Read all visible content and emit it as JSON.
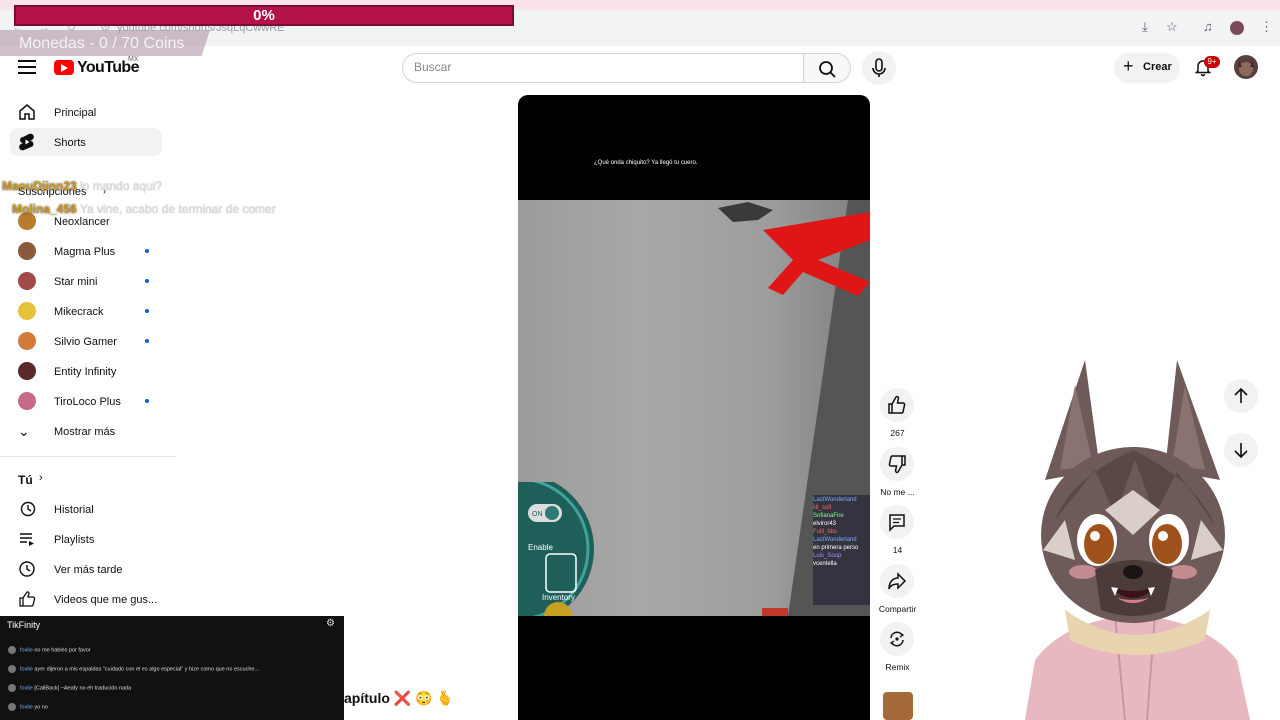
{
  "browser": {
    "url": "youtube.com/shorts/JsqLqCwwRE",
    "icons": [
      "back-icon",
      "forward-icon",
      "reload-icon",
      "site-info-icon",
      "install-icon",
      "star-icon",
      "media-icon",
      "profile-icon",
      "more-icon"
    ]
  },
  "overlay": {
    "progress_label": "0%",
    "progress_value": 0,
    "coins_label": "Monedas - 0 / 70 Coins",
    "chat": [
      {
        "user": "MaouDjinn23",
        "message": "lo mando aqui?"
      },
      {
        "user": "Molina_456",
        "message": "Ya vine, acabo de terminar de comer"
      }
    ]
  },
  "header": {
    "logo": "YouTube",
    "country": "MX",
    "search_placeholder": "Buscar",
    "create_label": "Crear",
    "notif_count": "9+",
    "colors": {
      "brand": "#ff0000",
      "badge": "#cc0000"
    }
  },
  "sidebar": {
    "main": [
      {
        "label": "Principal",
        "icon": "home-icon"
      },
      {
        "label": "Shorts",
        "icon": "shorts-icon",
        "active": true
      }
    ],
    "subs_title": "Suscripciones",
    "subs": [
      {
        "label": "Neoxlancer",
        "dot": false,
        "color": "#b87a2e"
      },
      {
        "label": "Magma Plus",
        "dot": true,
        "color": "#8b5a3c"
      },
      {
        "label": "Star mini",
        "dot": true,
        "color": "#a04a4a"
      },
      {
        "label": "Mikecrack",
        "dot": true,
        "color": "#e6c23a"
      },
      {
        "label": "Silvio Gamer",
        "dot": true,
        "color": "#d17a3a"
      },
      {
        "label": "Entity Infinity",
        "dot": false,
        "color": "#5a2a2a"
      },
      {
        "label": "TiroLoco Plus",
        "dot": true,
        "color": "#c46a8a"
      }
    ],
    "show_more": "Mostrar más",
    "you_title": "Tú",
    "you_items": [
      {
        "label": "Historial",
        "icon": "history-icon"
      },
      {
        "label": "Playlists",
        "icon": "playlists-icon"
      },
      {
        "label": "Ver más tarde",
        "icon": "watch-later-icon"
      },
      {
        "label": "Videos que me gus...",
        "icon": "liked-icon"
      }
    ]
  },
  "video": {
    "caption": "¿Qué onda chiquito? Ya llegó tu cuero.",
    "title_fragment": "apítulo ❌ 😳 🫰",
    "hud": {
      "toggle_on": "ON",
      "enable_label": "Enable",
      "inventory_label": "Inventory",
      "chat_lines": [
        "LastWonderland",
        "lilt_soll",
        "SofianaFire",
        "elviror43",
        "Fulli_bbs",
        "LastWonderland",
        "en primera perso",
        "Luis_Soup",
        "vcentella"
      ]
    }
  },
  "actions": [
    {
      "name": "like",
      "icon": "like-icon",
      "label": "267"
    },
    {
      "name": "dislike",
      "icon": "dislike-icon",
      "label": "No me ..."
    },
    {
      "name": "comments",
      "icon": "comments-icon",
      "label": "14"
    },
    {
      "name": "share",
      "icon": "share-icon",
      "label": "Compartir"
    },
    {
      "name": "remix",
      "icon": "remix-icon",
      "label": "Remix"
    }
  ],
  "chat_panel": {
    "title": "TikFinity",
    "messages": [
      {
        "user": "foxlie",
        "text": "no me hables por favor"
      },
      {
        "user": "foxlie",
        "text": "ayer dijeron a mis espaldas \"cuidado con el es algo especial\" y hize como que no escuche..."
      },
      {
        "user": "foxlie",
        "text": "[CallBack] ~Aeafy no eh traducido nada"
      },
      {
        "user": "foxlie",
        "text": "yo no"
      }
    ]
  }
}
